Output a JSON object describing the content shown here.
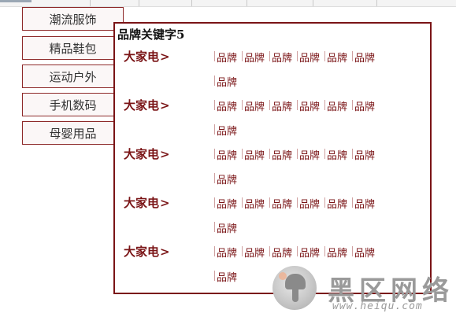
{
  "menu": {
    "items": [
      {
        "label": "潮流服饰"
      },
      {
        "label": "精品鞋包"
      },
      {
        "label": "运动户外"
      },
      {
        "label": "手机数码"
      },
      {
        "label": "母婴用品"
      }
    ]
  },
  "flyout": {
    "title": "品牌关键字5",
    "rows": [
      {
        "category": "大家电",
        "brands": [
          "品牌",
          "品牌",
          "品牌",
          "品牌",
          "品牌",
          "品牌",
          "品牌"
        ]
      },
      {
        "category": "大家电",
        "brands": [
          "品牌",
          "品牌",
          "品牌",
          "品牌",
          "品牌",
          "品牌",
          "品牌"
        ]
      },
      {
        "category": "大家电",
        "brands": [
          "品牌",
          "品牌",
          "品牌",
          "品牌",
          "品牌",
          "品牌",
          "品牌"
        ]
      },
      {
        "category": "大家电",
        "brands": [
          "品牌",
          "品牌",
          "品牌",
          "品牌",
          "品牌",
          "品牌",
          "品牌"
        ]
      },
      {
        "category": "大家电",
        "brands": [
          "品牌",
          "品牌",
          "品牌",
          "品牌",
          "品牌",
          "品牌",
          "品牌"
        ]
      }
    ]
  },
  "watermark": {
    "logo_icon": "mushroom-logo-icon",
    "name": "黑区网络",
    "url": "www.heiqu.com"
  },
  "colors": {
    "accent": "#7a1416",
    "menu_border": "#8e2a2a",
    "menu_bg": "#fbf7f7"
  }
}
